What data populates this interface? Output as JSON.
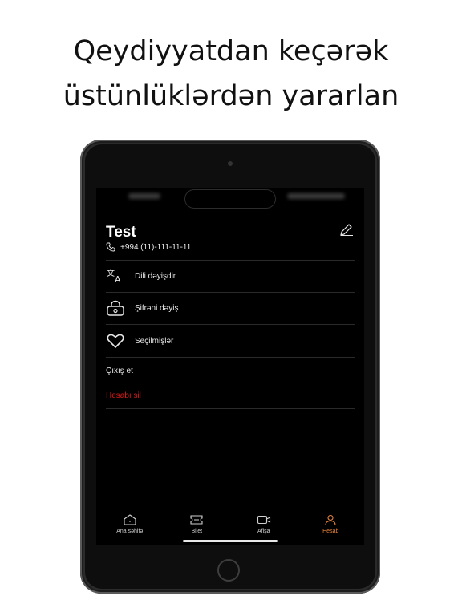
{
  "headline": {
    "line1": "Qeydiyyatdan keçərək",
    "line2": "üstünlüklərdən yararlan"
  },
  "profile": {
    "name": "Test",
    "phone": "+994 (11)-111-11-11"
  },
  "menu": [
    {
      "label": "Dili dəyişdir",
      "icon": "translate-icon"
    },
    {
      "label": "Şifrəni dəyiş",
      "icon": "lock-icon"
    },
    {
      "label": "Seçilmişlər",
      "icon": "heart-icon"
    }
  ],
  "logout_label": "Çıxış et",
  "delete_account_label": "Hesabı sil",
  "tabs": [
    {
      "label": "Ana səhifə",
      "icon": "home-icon"
    },
    {
      "label": "Bilet",
      "icon": "ticket-icon"
    },
    {
      "label": "Afişa",
      "icon": "video-icon"
    },
    {
      "label": "Hesab",
      "icon": "user-icon"
    }
  ],
  "colors": {
    "accent": "#e8843c",
    "danger": "#e11818",
    "background": "#000000"
  }
}
